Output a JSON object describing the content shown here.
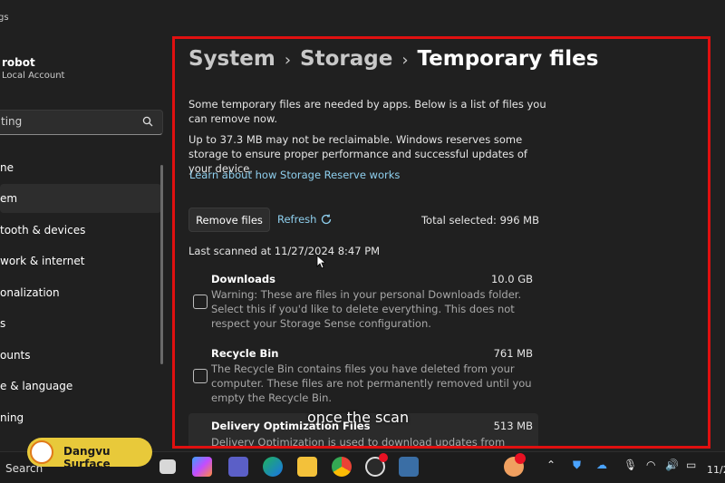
{
  "window": {
    "title_fragment": "gs"
  },
  "account": {
    "name": "robot",
    "type": "Local Account"
  },
  "search": {
    "value": "ting"
  },
  "nav": [
    {
      "label": "ne",
      "active": false
    },
    {
      "label": "em",
      "active": true
    },
    {
      "label": "tooth & devices",
      "active": false
    },
    {
      "label": "work & internet",
      "active": false
    },
    {
      "label": "onalization",
      "active": false
    },
    {
      "label": "s",
      "active": false
    },
    {
      "label": "ounts",
      "active": false
    },
    {
      "label": "e & language",
      "active": false
    },
    {
      "label": "ning",
      "active": false
    }
  ],
  "breadcrumb": {
    "first": "System",
    "second": "Storage",
    "current": "Temporary files"
  },
  "intro": "Some temporary files are needed by apps. Below is a list of files you can remove now.",
  "reserve_note": "Up to 37.3 MB may not be reclaimable. Windows reserves some storage to ensure proper performance and successful updates of your device.",
  "reserve_link": "Learn about how Storage Reserve works",
  "actions": {
    "remove_label": "Remove files",
    "refresh_label": "Refresh",
    "total_selected": "Total selected: 996 MB"
  },
  "last_scanned": "Last scanned at 11/27/2024 8:47 PM",
  "items": [
    {
      "title": "Downloads",
      "size": "10.0 GB",
      "description": "Warning: These are files in your personal Downloads folder. Select this if you'd like to delete everything. This does not respect your Storage Sense configuration."
    },
    {
      "title": "Recycle Bin",
      "size": "761 MB",
      "description": "The Recycle Bin contains files you have deleted from your computer. These files are not permanently removed until you empty the Recycle Bin."
    },
    {
      "title": "Delivery Optimization Files",
      "size": "513 MB",
      "description": "Delivery Optimization is used to download updates from"
    }
  ],
  "caption": "once the scan",
  "taskbar": {
    "search_label": "Search",
    "brand": "Dangvu Surface",
    "tray_time": "11/2"
  },
  "colors": {
    "accent_link": "#8fd0ef",
    "highlight_border": "#e01010",
    "background": "#202020"
  }
}
